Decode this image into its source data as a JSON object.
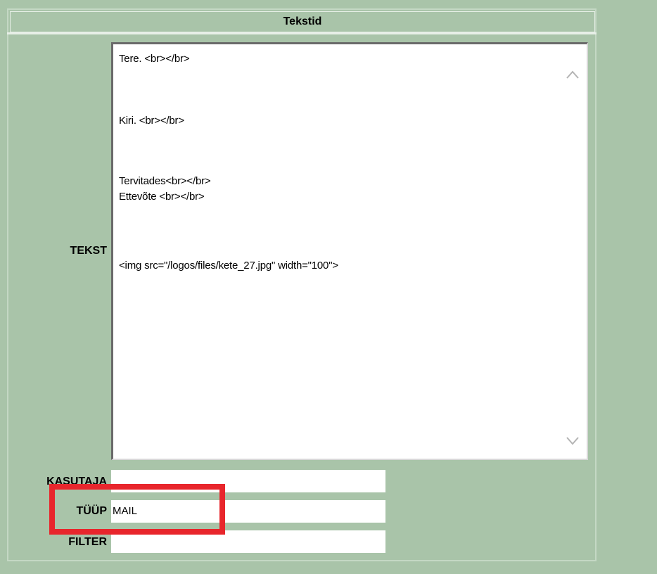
{
  "panel": {
    "title": "Tekstid"
  },
  "form": {
    "tekst_label": "TEKST",
    "tekst_lines": [
      "Tere. <br></br>",
      "Kiri. <br></br>",
      "Tervitades<br></br>",
      "Ettevõte <br></br>",
      "<img src=\"/logos/files/kete_27.jpg\" width=\"100\">"
    ],
    "kasutaja_label": "KASUTAJA",
    "kasutaja_value": "",
    "tyyp_label": "TÜÜP",
    "tyyp_value": "MAIL",
    "filter_label": "FILTER",
    "filter_value": ""
  },
  "annotation": {
    "color": "#e8262c"
  },
  "colors": {
    "background": "#a9c4a9",
    "field_bg": "#ffffff"
  },
  "icons": {
    "scroll_up": "chevron-up-icon",
    "scroll_down": "chevron-down-icon"
  }
}
